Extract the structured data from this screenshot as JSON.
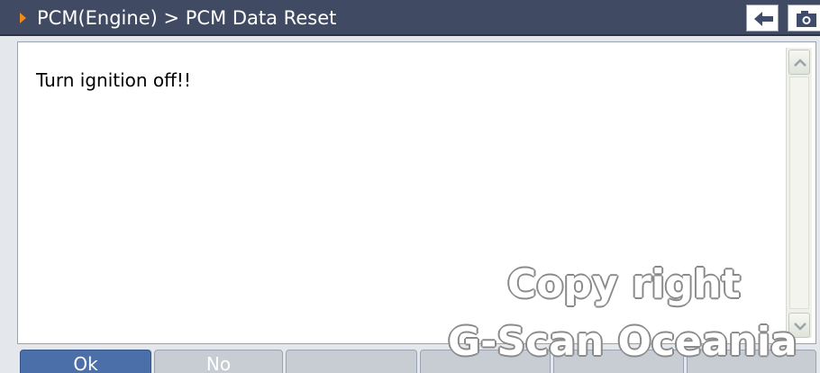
{
  "header": {
    "breadcrumb": "PCM(Engine) > PCM Data Reset",
    "accent_color": "#f08a1a",
    "back_icon": "back-arrow-icon",
    "camera_icon": "camera-icon"
  },
  "content": {
    "message": "Turn ignition off!!"
  },
  "scrollbar": {
    "up_icon": "chevron-up-icon",
    "down_icon": "chevron-down-icon"
  },
  "buttons": [
    {
      "label": "Ok",
      "active": true
    },
    {
      "label": "No",
      "active": false
    },
    {
      "label": "",
      "active": false
    },
    {
      "label": "",
      "active": false
    },
    {
      "label": "",
      "active": false
    },
    {
      "label": "",
      "active": false
    }
  ],
  "watermark": {
    "line1": "Copy right",
    "line2": "G-Scan Oceania"
  }
}
